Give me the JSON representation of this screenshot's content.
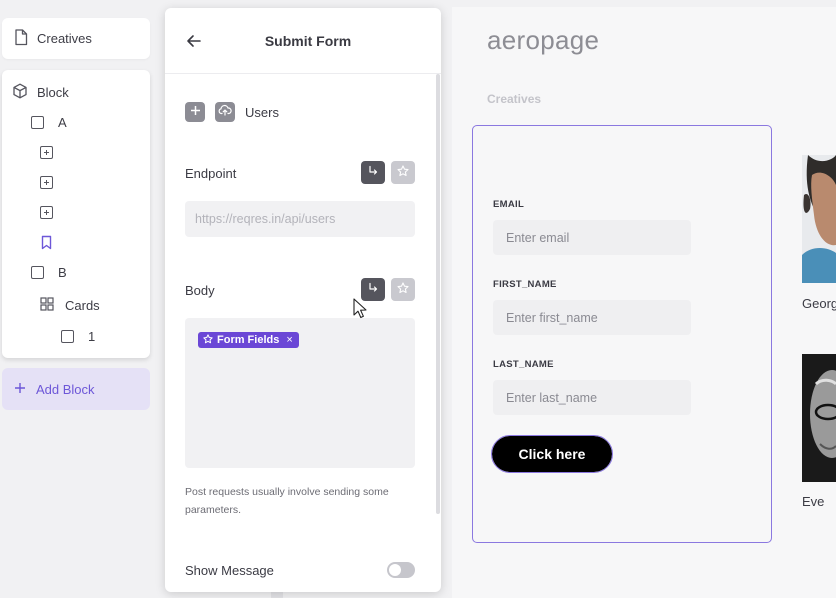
{
  "sidebar": {
    "creatives_label": "Creatives",
    "block_label": "Block",
    "tree": [
      {
        "label": "A"
      },
      {
        "label": "B"
      },
      {
        "label": "Cards"
      },
      {
        "label": "1"
      }
    ],
    "add_block_label": "Add Block"
  },
  "panel": {
    "title": "Submit Form",
    "users_label": "Users",
    "endpoint_label": "Endpoint",
    "endpoint_placeholder": "https://reqres.in/api/users",
    "body_label": "Body",
    "chip_label": "Form Fields",
    "chip_remove": "×",
    "hint": "Post requests usually involve sending some parameters.",
    "show_message_label": "Show Message",
    "show_message_on": false
  },
  "canvas": {
    "brand": "aeropage",
    "breadcrumb": "Creatives",
    "form": {
      "fields": [
        {
          "label": "EMAIL",
          "placeholder": "Enter email"
        },
        {
          "label": "FIRST_NAME",
          "placeholder": "Enter first_name"
        },
        {
          "label": "LAST_NAME",
          "placeholder": "Enter last_name"
        }
      ],
      "button_label": "Click here"
    },
    "people": [
      {
        "name": "George"
      },
      {
        "name": "Eve"
      }
    ]
  },
  "colors": {
    "accent": "#6b47d6",
    "accent_light": "#e5e1f6",
    "form_border": "#8b78e0"
  }
}
